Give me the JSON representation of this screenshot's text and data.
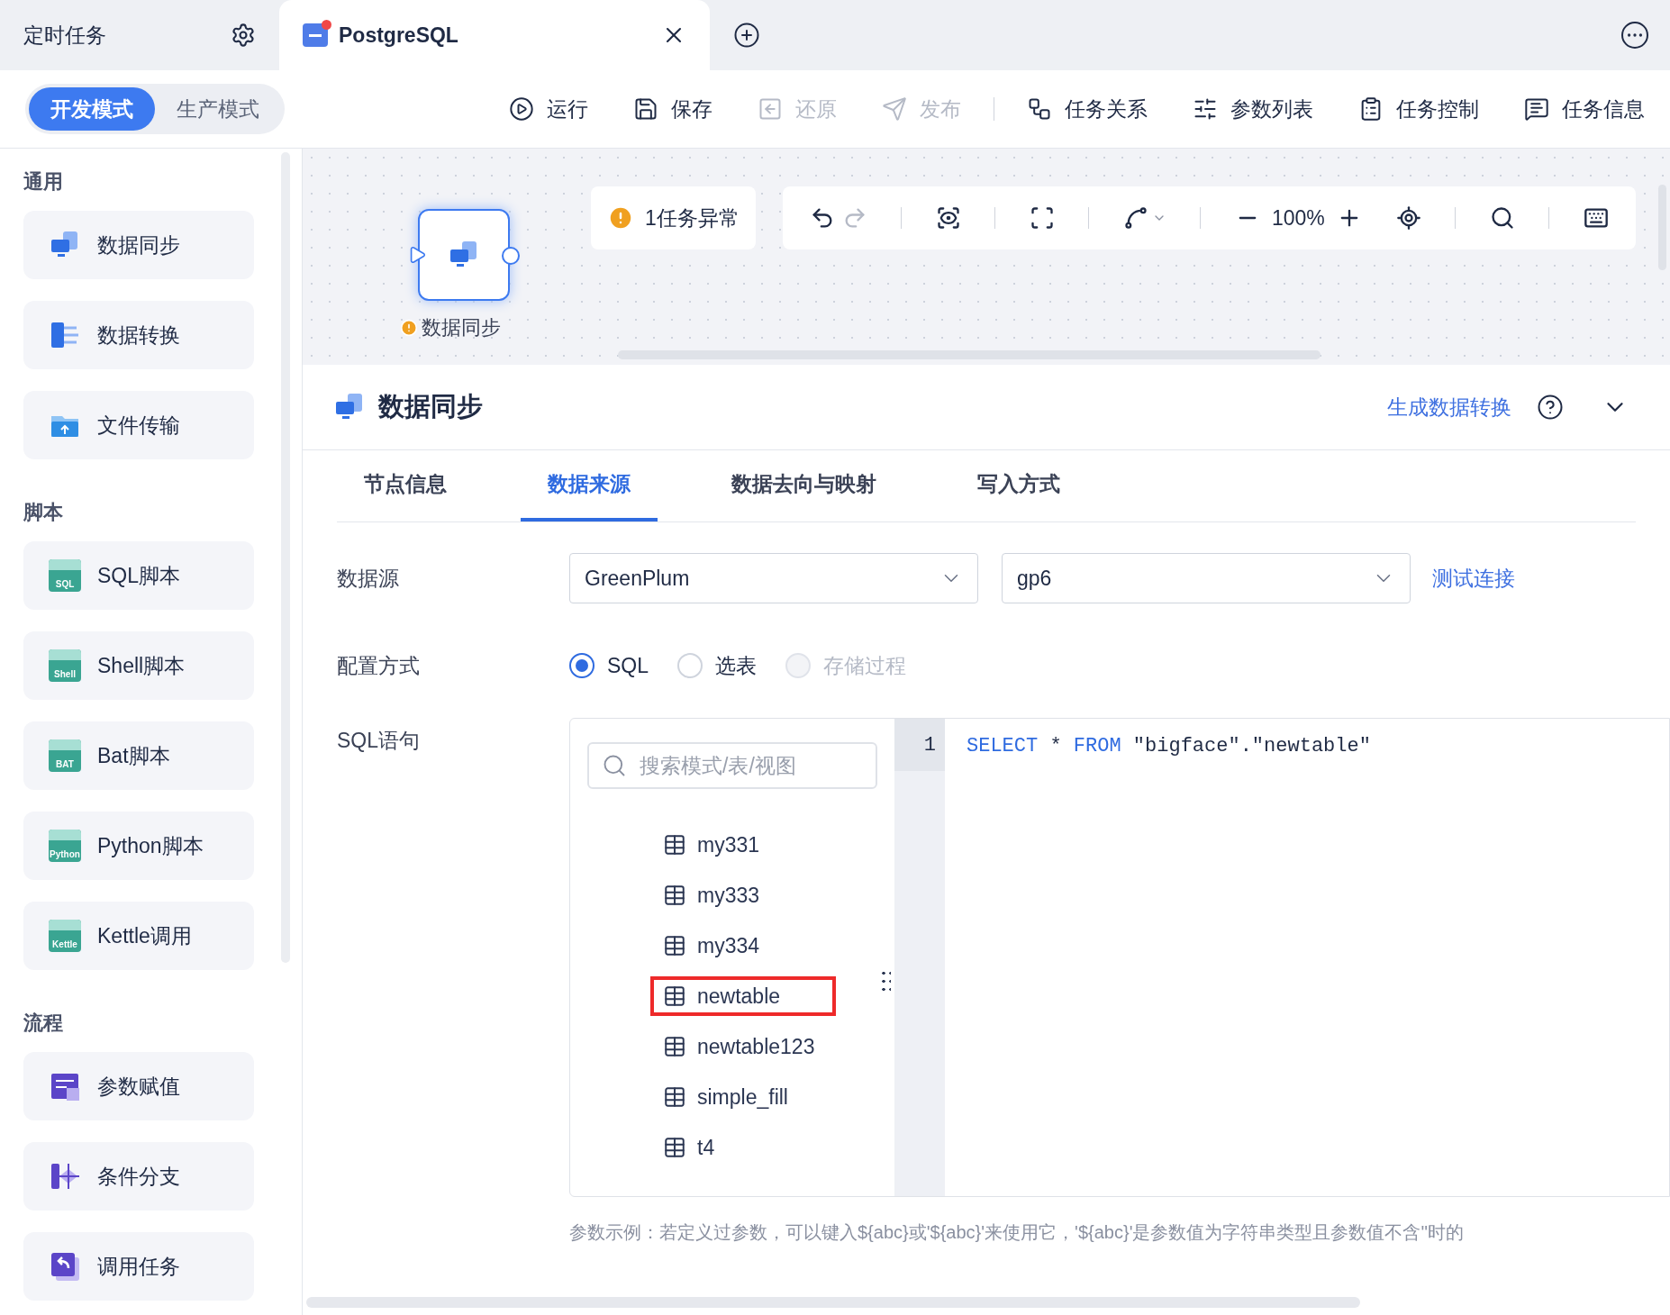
{
  "window_tabs": [
    {
      "label": "定时任务",
      "selected": false,
      "kind": "settings"
    },
    {
      "label": "PostgreSQL",
      "selected": true,
      "kind": "db"
    }
  ],
  "mode_toggle": [
    {
      "label": "开发模式",
      "selected": true
    },
    {
      "label": "生产模式",
      "selected": false
    }
  ],
  "toolbar": [
    {
      "label": "运行",
      "kind": "run",
      "disabled": false
    },
    {
      "label": "保存",
      "kind": "save",
      "disabled": false
    },
    {
      "label": "还原",
      "kind": "restore",
      "disabled": true
    },
    {
      "label": "发布",
      "kind": "publish",
      "disabled": true
    },
    {
      "label": "任务关系",
      "kind": "relation",
      "disabled": false
    },
    {
      "label": "参数列表",
      "kind": "params",
      "disabled": false
    },
    {
      "label": "任务控制",
      "kind": "control",
      "disabled": false
    },
    {
      "label": "任务信息",
      "kind": "info",
      "disabled": false
    }
  ],
  "sidebar": [
    {
      "title": "通用",
      "items": [
        {
          "label": "数据同步",
          "kind": "sync"
        },
        {
          "label": "数据转换",
          "kind": "transform"
        },
        {
          "label": "文件传输",
          "kind": "file"
        }
      ]
    },
    {
      "title": "脚本",
      "items": [
        {
          "label": "SQL脚本",
          "kind": "script",
          "icon_text": "SQL"
        },
        {
          "label": "Shell脚本",
          "kind": "script",
          "icon_text": "Shell"
        },
        {
          "label": "Bat脚本",
          "kind": "script",
          "icon_text": "BAT"
        },
        {
          "label": "Python脚本",
          "kind": "script",
          "icon_text": "Python"
        },
        {
          "label": "Kettle调用",
          "kind": "script",
          "icon_text": "Kettle"
        }
      ]
    },
    {
      "title": "流程",
      "items": [
        {
          "label": "参数赋值",
          "kind": "assign"
        },
        {
          "label": "条件分支",
          "kind": "branch"
        },
        {
          "label": "调用任务",
          "kind": "call"
        }
      ]
    }
  ],
  "canvas": {
    "node": {
      "label": "数据同步",
      "warning": true
    },
    "alert": "1任务异常",
    "zoom": "100%"
  },
  "panel": {
    "title": "数据同步",
    "action_link": "生成数据转换",
    "tabs": [
      {
        "label": "节点信息",
        "selected": false
      },
      {
        "label": "数据来源",
        "selected": true
      },
      {
        "label": "数据去向与映射",
        "selected": false
      },
      {
        "label": "写入方式",
        "selected": false
      }
    ],
    "datasource": {
      "label": "数据源",
      "type": "GreenPlum",
      "name": "gp6",
      "test_link": "测试连接"
    },
    "config": {
      "label": "配置方式",
      "options": [
        {
          "label": "SQL",
          "selected": true,
          "disabled": false
        },
        {
          "label": "选表",
          "selected": false,
          "disabled": false
        },
        {
          "label": "存储过程",
          "selected": false,
          "disabled": true
        }
      ]
    },
    "sql": {
      "label": "SQL语句",
      "search": {
        "placeholder": "搜索模式/表/视图"
      },
      "tables": [
        {
          "name": "my331",
          "highlighted": false
        },
        {
          "name": "my333",
          "highlighted": false
        },
        {
          "name": "my334",
          "highlighted": false
        },
        {
          "name": "newtable",
          "highlighted": true
        },
        {
          "name": "newtable123",
          "highlighted": false
        },
        {
          "name": "simple_fill",
          "highlighted": false
        },
        {
          "name": "t4",
          "highlighted": false
        }
      ],
      "code": [
        {
          "number": "1",
          "tokens": [
            {
              "text": "SELECT",
              "kind": "keyword"
            },
            {
              "text": " * ",
              "kind": "plain"
            },
            {
              "text": "FROM",
              "kind": "keyword"
            },
            {
              "text": " \"bigface\".\"newtable\"",
              "kind": "plain"
            }
          ]
        }
      ]
    },
    "hint": "参数示例：若定义过参数，可以键入${abc}或'${abc}'来使用它，'${abc}'是参数值为字符串类型且参数值不含''时的"
  }
}
